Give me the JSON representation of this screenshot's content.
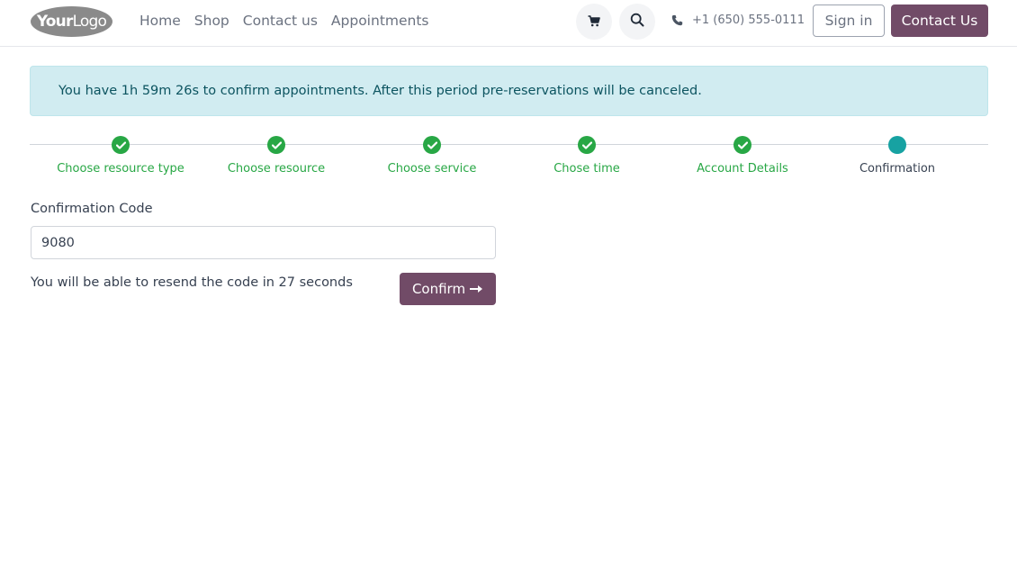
{
  "header": {
    "logo_text_bold": "Your",
    "logo_text_light": "Logo",
    "nav": [
      "Home",
      "Shop",
      "Contact us",
      "Appointments"
    ],
    "cart_icon": "cart-icon",
    "search_icon": "search-icon",
    "phone_icon": "phone-icon",
    "phone": "+1 (650) 555-0111",
    "sign_in": "Sign in",
    "contact_us": "Contact Us"
  },
  "alert": {
    "text": "You have 1h 59m 26s to confirm appointments. After this period pre-reservations will be canceled."
  },
  "steps": [
    {
      "label": "Choose resource type",
      "status": "done"
    },
    {
      "label": "Choose resource",
      "status": "done"
    },
    {
      "label": "Choose service",
      "status": "done"
    },
    {
      "label": "Chose time",
      "status": "done"
    },
    {
      "label": "Account Details",
      "status": "done"
    },
    {
      "label": "Confirmation",
      "status": "current"
    }
  ],
  "form": {
    "label": "Confirmation Code",
    "code_value": "9080",
    "resend_text": "You will be able to resend the code in 27 seconds",
    "confirm_label": "Confirm",
    "confirm_icon": "arrow-right-icon"
  },
  "colors": {
    "brand": "#714b67",
    "success": "#28a745",
    "current_step": "#17a2a2",
    "alert_bg": "#d1ecf1",
    "alert_text": "#0c5460"
  }
}
